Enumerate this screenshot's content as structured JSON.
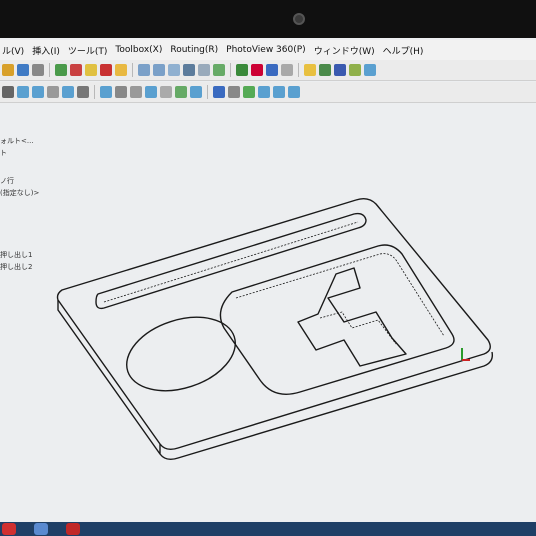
{
  "menu": {
    "items": [
      "ル(V)",
      "挿入(I)",
      "ツール(T)",
      "Toolbox(X)",
      "Routing(R)",
      "PhotoView 360(P)",
      "ウィンドウ(W)",
      "ヘルプ(H)"
    ]
  },
  "tree": {
    "items": [
      "ォルト<...",
      "ト",
      "ノ行",
      "(指定なし)>",
      "押し出し1",
      "押し出し2"
    ]
  },
  "colors": {
    "toolbar_bg": "#ebebeb",
    "viewport_bg": "#eceef0",
    "model_edge": "#1a1a1a",
    "taskbar": "#1f3f66"
  }
}
